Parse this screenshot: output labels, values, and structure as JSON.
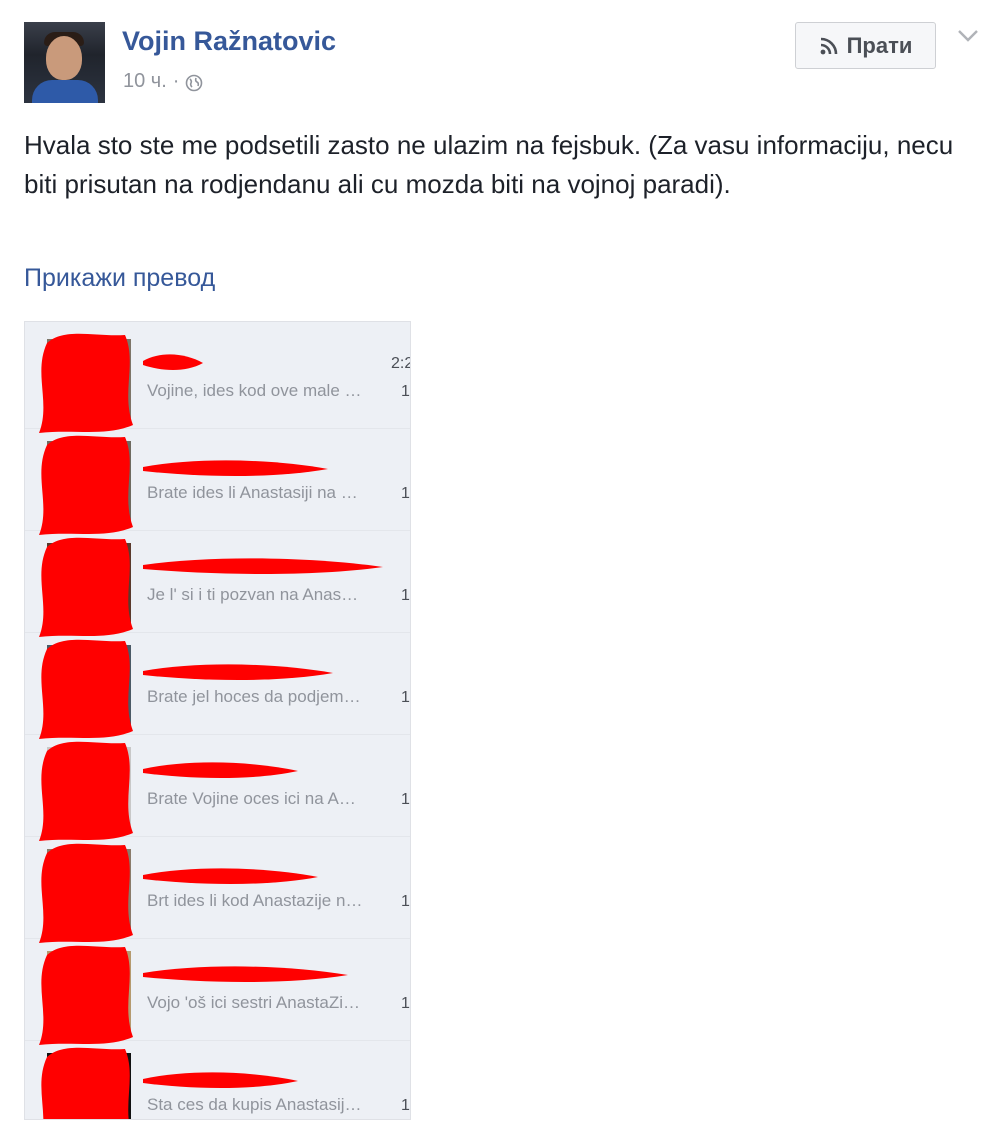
{
  "post": {
    "author": "Vojin Ražnatovic",
    "time": "10 ч.",
    "separator": "·",
    "follow_label": "Прати",
    "text": "Hvala sto ste me podsetili zasto ne ulazim na fejsbuk. (Za vasu informaciju, necu biti prisutan na rodjendanu ali cu mozda biti na vojnoj paradi).",
    "translate_link": "Прикажи превод",
    "icons": {
      "audience": "globe-icon",
      "follow": "rss-icon",
      "menu": "chevron-down-icon"
    }
  },
  "attachment": {
    "messages": [
      {
        "preview": "Vojine, ides kod ove male …",
        "time": "2:2",
        "suffix": "1"
      },
      {
        "preview": "Brate ides li Anastasiji na …",
        "suffix": "1"
      },
      {
        "preview": "Je l' si i ti pozvan na Anas…",
        "suffix": "1"
      },
      {
        "preview": "Brate jel hoces da podjem…",
        "suffix": "1"
      },
      {
        "preview": "Brate Vojine oces ici na A…",
        "suffix": "1"
      },
      {
        "preview": "Brt ides li kod Anastazije n…",
        "suffix": "1"
      },
      {
        "preview": "Vojo 'oš ici sestri AnastaZi…",
        "suffix": "1"
      },
      {
        "preview": "Sta ces da kupis Anastasij…",
        "suffix": "1"
      }
    ],
    "redaction_color": "#ff0000"
  },
  "colors": {
    "link": "#365899",
    "muted": "#90949c",
    "text": "#1d2129"
  }
}
